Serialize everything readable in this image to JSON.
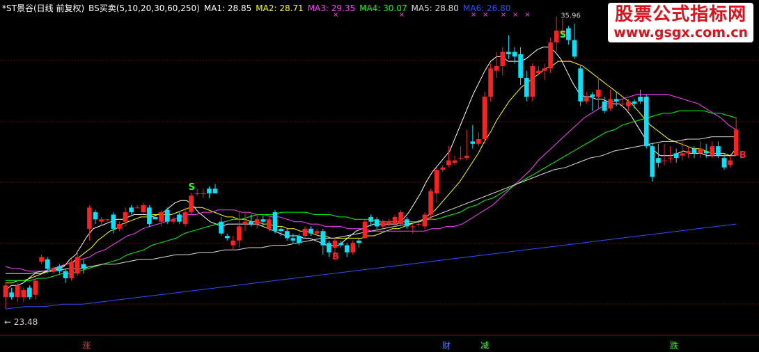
{
  "header": {
    "stock": "*ST景谷(日线 前复权)",
    "indicator": "BS买卖(5,10,20,30,60,250)",
    "ma": [
      {
        "label": "MA1: 28.85",
        "color": "#ffffff"
      },
      {
        "label": "MA2: 28.71",
        "color": "#ffff00"
      },
      {
        "label": "MA3: 29.35",
        "color": "#ff40ff"
      },
      {
        "label": "MA4: 30.07",
        "color": "#00ff00"
      },
      {
        "label": "MA5: 28.80",
        "color": "#dddddd"
      },
      {
        "label": "MA6: 26.80",
        "color": "#3050ff"
      }
    ]
  },
  "watermark": {
    "title": "股票公式指标网",
    "url": "www.gsgx.com.cn"
  },
  "low_label": "← 23.48",
  "bottom_flags": [
    {
      "text": "涨",
      "color": "#ff3030"
    },
    {
      "text": "财",
      "color": "#4080ff"
    },
    {
      "text": "减",
      "color": "#30ff30"
    },
    {
      "text": "跌",
      "color": "#30ff30"
    }
  ],
  "chart_data": {
    "type": "candlestick",
    "ylim": [
      22.5,
      36.6
    ],
    "candles": [
      [
        24.0,
        24.5,
        23.5,
        24.6
      ],
      [
        24.2,
        24.0,
        23.9,
        24.4
      ],
      [
        24.0,
        24.5,
        23.8,
        24.6
      ],
      [
        24.0,
        24.3,
        23.8,
        24.4
      ],
      [
        24.4,
        24.0,
        23.9,
        24.5
      ],
      [
        24.1,
        24.7,
        23.9,
        24.8
      ],
      [
        25.5,
        25.7,
        25.4,
        25.8
      ],
      [
        25.6,
        25.2,
        25.0,
        25.7
      ],
      [
        25.1,
        25.2,
        25.0,
        25.3
      ],
      [
        25.3,
        25.1,
        25.0,
        25.4
      ],
      [
        25.1,
        24.8,
        24.6,
        25.2
      ],
      [
        24.8,
        25.5,
        24.7,
        25.6
      ],
      [
        25.0,
        25.7,
        24.9,
        26.0
      ],
      [
        25.4,
        25.2,
        25.0,
        25.6
      ],
      [
        26.9,
        27.8,
        26.4,
        27.9
      ],
      [
        27.6,
        27.3,
        27.1,
        27.7
      ],
      [
        27.2,
        27.3,
        27.0,
        27.4
      ],
      [
        27.3,
        27.3,
        27.2,
        27.3
      ],
      [
        27.5,
        26.9,
        26.7,
        27.6
      ],
      [
        26.9,
        27.1,
        26.8,
        27.2
      ],
      [
        27.2,
        27.6,
        27.0,
        27.8
      ],
      [
        27.8,
        27.6,
        27.5,
        27.9
      ],
      [
        27.8,
        27.8,
        27.8,
        27.9
      ],
      [
        27.6,
        27.9,
        27.5,
        28.0
      ],
      [
        27.8,
        27.1,
        27.0,
        27.9
      ],
      [
        27.4,
        27.3,
        27.3,
        27.4
      ],
      [
        27.2,
        27.6,
        27.0,
        27.7
      ],
      [
        27.7,
        27.2,
        27.1,
        27.8
      ],
      [
        27.2,
        27.3,
        27.1,
        27.4
      ],
      [
        27.5,
        27.2,
        27.1,
        27.6
      ],
      [
        27.1,
        27.6,
        27.0,
        27.8
      ],
      [
        27.6,
        28.3,
        27.5,
        28.4
      ],
      [
        28.4,
        28.4,
        28.3,
        28.6
      ],
      [
        28.4,
        28.4,
        28.2,
        28.6
      ],
      [
        28.6,
        28.4,
        28.2,
        28.7
      ],
      [
        28.6,
        28.4,
        28.4,
        28.8
      ],
      [
        27.2,
        26.7,
        26.6,
        27.4
      ],
      [
        26.6,
        26.5,
        26.4,
        26.7
      ],
      [
        26.2,
        26.4,
        26.0,
        26.6
      ],
      [
        26.4,
        27.0,
        26.1,
        27.6
      ],
      [
        27.1,
        27.2,
        26.8,
        27.6
      ],
      [
        27.2,
        27.1,
        27.0,
        27.5
      ],
      [
        27.1,
        27.3,
        26.9,
        27.5
      ],
      [
        27.3,
        27.2,
        27.0,
        27.5
      ],
      [
        26.9,
        27.3,
        26.8,
        27.4
      ],
      [
        27.6,
        26.8,
        26.7,
        27.7
      ],
      [
        26.9,
        26.8,
        26.6,
        27.0
      ],
      [
        26.8,
        26.5,
        26.4,
        26.9
      ],
      [
        26.5,
        26.4,
        26.3,
        26.7
      ],
      [
        26.6,
        26.3,
        26.2,
        26.7
      ],
      [
        26.6,
        26.9,
        26.5,
        27.0
      ],
      [
        26.9,
        26.7,
        26.6,
        27.0
      ],
      [
        26.7,
        26.8,
        26.6,
        26.9
      ],
      [
        26.8,
        26.2,
        25.8,
        26.9
      ],
      [
        26.3,
        25.9,
        25.7,
        26.4
      ],
      [
        26.1,
        26.4,
        25.8,
        26.5
      ],
      [
        26.3,
        26.2,
        26.1,
        26.4
      ],
      [
        26.2,
        25.9,
        25.7,
        26.3
      ],
      [
        25.9,
        26.3,
        25.8,
        26.4
      ],
      [
        26.4,
        26.3,
        26.1,
        26.5
      ],
      [
        26.5,
        27.2,
        26.5,
        27.3
      ],
      [
        27.4,
        27.2,
        27.0,
        27.5
      ],
      [
        27.3,
        27.0,
        26.9,
        27.4
      ],
      [
        27.0,
        27.2,
        26.9,
        27.3
      ],
      [
        27.1,
        27.2,
        27.0,
        27.3
      ],
      [
        27.1,
        27.4,
        27.0,
        27.5
      ],
      [
        27.1,
        27.6,
        27.0,
        27.7
      ],
      [
        27.3,
        27.0,
        26.9,
        27.4
      ],
      [
        27.0,
        27.0,
        26.7,
        27.1
      ],
      [
        27.1,
        27.1,
        27.0,
        27.2
      ],
      [
        27.0,
        27.5,
        26.9,
        27.6
      ],
      [
        27.5,
        28.5,
        27.3,
        28.6
      ],
      [
        28.4,
        29.4,
        28.0,
        29.5
      ],
      [
        29.4,
        29.5,
        29.3,
        29.6
      ],
      [
        29.6,
        29.8,
        29.5,
        30.4
      ],
      [
        29.7,
        29.8,
        29.6,
        30.0
      ],
      [
        29.9,
        29.9,
        29.8,
        30.4
      ],
      [
        29.9,
        30.0,
        29.8,
        31.1
      ],
      [
        30.6,
        30.5,
        30.3,
        31.3
      ],
      [
        30.5,
        30.7,
        30.4,
        31.0
      ],
      [
        30.7,
        32.5,
        30.5,
        32.7
      ],
      [
        32.5,
        33.7,
        32.3,
        33.9
      ],
      [
        33.6,
        33.8,
        33.3,
        34.4
      ],
      [
        33.8,
        34.4,
        33.4,
        34.6
      ],
      [
        34.4,
        34.3,
        34.1,
        35.1
      ],
      [
        34.4,
        34.2,
        33.9,
        34.6
      ],
      [
        34.3,
        33.3,
        33.0,
        34.6
      ],
      [
        33.3,
        32.5,
        32.3,
        33.6
      ],
      [
        32.5,
        33.8,
        32.3,
        33.9
      ],
      [
        33.5,
        33.6,
        33.4,
        33.8
      ],
      [
        33.6,
        33.7,
        33.2,
        33.9
      ],
      [
        33.7,
        34.8,
        33.5,
        35.0
      ],
      [
        34.8,
        35.3,
        34.4,
        35.9
      ],
      [
        35.2,
        35.3,
        35.0,
        35.8
      ],
      [
        35.4,
        34.9,
        34.7,
        35.5
      ],
      [
        34.9,
        34.2,
        34.1,
        35.6
      ],
      [
        33.7,
        32.3,
        32.1,
        33.8
      ],
      [
        32.3,
        32.5,
        32.2,
        32.7
      ],
      [
        32.6,
        32.5,
        31.9,
        32.7
      ],
      [
        32.5,
        32.8,
        32.0,
        33.3
      ],
      [
        32.3,
        31.9,
        31.8,
        32.5
      ],
      [
        32.0,
        32.4,
        31.9,
        32.8
      ],
      [
        32.4,
        32.3,
        32.1,
        32.7
      ],
      [
        32.2,
        32.2,
        32.1,
        32.4
      ],
      [
        32.1,
        32.3,
        31.9,
        32.4
      ],
      [
        32.3,
        32.2,
        32.0,
        32.4
      ],
      [
        32.5,
        32.3,
        32.2,
        32.8
      ],
      [
        32.5,
        30.4,
        30.3,
        32.6
      ],
      [
        30.4,
        29.1,
        28.9,
        30.5
      ],
      [
        29.9,
        29.7,
        29.5,
        30.5
      ],
      [
        29.8,
        29.8,
        29.6,
        30.5
      ],
      [
        29.9,
        29.9,
        29.7,
        30.4
      ],
      [
        30.1,
        29.9,
        29.7,
        30.3
      ],
      [
        30.0,
        30.1,
        29.8,
        30.7
      ],
      [
        30.1,
        30.2,
        29.9,
        30.4
      ],
      [
        30.3,
        30.1,
        29.9,
        30.4
      ],
      [
        30.1,
        30.3,
        29.9,
        30.6
      ],
      [
        30.2,
        30.1,
        29.9,
        30.5
      ],
      [
        30.0,
        30.4,
        29.9,
        30.6
      ],
      [
        30.4,
        30.0,
        29.9,
        30.6
      ],
      [
        29.9,
        29.5,
        29.4,
        30.1
      ],
      [
        29.6,
        29.8,
        29.5,
        30.0
      ],
      [
        30.0,
        31.1,
        30.0,
        31.6
      ]
    ],
    "ma_lines": [
      {
        "name": "MA1",
        "color": "#ffffff",
        "values": [
          24.3,
          24.5,
          24.5,
          24.6,
          24.8,
          25.0,
          25.0,
          25.1,
          25.1,
          25.2,
          25.3,
          25.6,
          25.8,
          26.2,
          26.6,
          26.9,
          27.0,
          27.1,
          27.2,
          27.3,
          27.3,
          27.4,
          27.5,
          27.5,
          27.5,
          27.4,
          27.5,
          27.6,
          27.8,
          28.0,
          28.1,
          28.1,
          27.9,
          27.6,
          27.4,
          27.2,
          27.1,
          27.0,
          27.1,
          27.1,
          27.1,
          27.1,
          27.1,
          27.1,
          27.0,
          26.9,
          26.8,
          26.7,
          26.6,
          26.6,
          26.6,
          26.5,
          26.5,
          26.4,
          26.3,
          26.2,
          26.2,
          26.2,
          26.4,
          26.6,
          26.8,
          26.9,
          27.0,
          27.1,
          27.1,
          27.1,
          27.1,
          27.1,
          27.3,
          27.6,
          28.0,
          28.4,
          28.9,
          29.3,
          29.6,
          29.9,
          30.2,
          30.8,
          31.4,
          32.0,
          32.6,
          33.1,
          33.6,
          34.0,
          34.2,
          34.2,
          34.0,
          34.0,
          34.0,
          34.1,
          34.3,
          34.5,
          34.6,
          34.6,
          34.4,
          34.1,
          33.6,
          33.1,
          32.7,
          32.5,
          32.5,
          32.4,
          32.4,
          32.3,
          32.2,
          32.2,
          32.0,
          31.7,
          31.3,
          30.9,
          30.5,
          30.2,
          30.0,
          30.0,
          30.0,
          30.1,
          30.2,
          30.1,
          30.1,
          30.1,
          30.0,
          30.0,
          30.0,
          30.0,
          30.0,
          30.3
        ]
      },
      {
        "name": "MA2",
        "color": "#ffff00",
        "values": [
          24.6,
          24.6,
          24.7,
          24.7,
          24.8,
          24.9,
          25.0,
          25.1,
          25.2,
          25.3,
          25.4,
          25.5,
          25.7,
          25.9,
          26.1,
          26.4,
          26.6,
          26.8,
          26.9,
          27.1,
          27.2,
          27.3,
          27.4,
          27.4,
          27.5,
          27.5,
          27.5,
          27.5,
          27.6,
          27.7,
          27.8,
          27.8,
          27.8,
          27.7,
          27.6,
          27.5,
          27.4,
          27.4,
          27.3,
          27.3,
          27.2,
          27.2,
          27.1,
          27.1,
          27.0,
          27.0,
          26.9,
          26.9,
          26.8,
          26.8,
          26.7,
          26.6,
          26.6,
          26.5,
          26.5,
          26.5,
          26.5,
          26.5,
          26.5,
          26.6,
          26.6,
          26.7,
          26.8,
          26.9,
          26.9,
          27.0,
          27.1,
          27.2,
          27.3,
          27.5,
          27.7,
          28.0,
          28.3,
          28.6,
          28.9,
          29.3,
          29.7,
          30.1,
          30.6,
          31.0,
          31.5,
          31.9,
          32.3,
          32.6,
          32.9,
          33.1,
          33.3,
          33.5,
          33.7,
          33.8,
          34.0,
          34.0,
          34.0,
          33.9,
          33.8,
          33.6,
          33.4,
          33.2,
          33.0,
          32.8,
          32.6,
          32.4,
          32.2,
          31.9,
          31.6,
          31.3,
          31.1,
          30.9,
          30.7,
          30.6,
          30.5,
          30.4,
          30.3,
          30.3,
          30.2,
          30.1,
          30.1,
          30.1,
          30.0,
          30.0
        ]
      },
      {
        "name": "MA3",
        "color": "#ff40ff",
        "values": [
          25.3,
          25.2,
          25.2,
          25.1,
          25.1,
          25.1,
          25.2,
          25.3,
          25.4,
          25.5,
          25.6,
          25.7,
          25.9,
          26.0,
          26.2,
          26.4,
          26.6,
          26.7,
          26.9,
          27.0,
          27.1,
          27.2,
          27.3,
          27.4,
          27.5,
          27.5,
          27.6,
          27.6,
          27.7,
          27.7,
          27.7,
          27.6,
          27.6,
          27.5,
          27.5,
          27.4,
          27.4,
          27.3,
          27.2,
          27.2,
          27.1,
          27.1,
          27.0,
          27.0,
          27.0,
          26.9,
          26.9,
          26.9,
          26.8,
          26.8,
          26.8,
          26.8,
          26.8,
          26.8,
          26.8,
          26.8,
          26.9,
          26.9,
          27.0,
          27.0,
          27.1,
          27.3,
          27.5,
          27.7,
          27.9,
          28.2,
          28.5,
          28.8,
          29.1,
          29.4,
          29.8,
          30.1,
          30.4,
          30.7,
          31.0,
          31.3,
          31.6,
          31.8,
          32.0,
          32.2,
          32.3,
          32.4,
          32.5,
          32.6,
          32.6,
          32.6,
          32.6,
          32.6,
          32.5,
          32.4,
          32.3,
          32.2,
          32.0,
          31.8,
          31.6,
          31.3,
          31.1
        ]
      },
      {
        "name": "MA4",
        "color": "#00ff00",
        "values": [
          24.7,
          24.7,
          24.7,
          24.7,
          24.8,
          24.8,
          24.9,
          25.0,
          25.0,
          25.1,
          25.2,
          25.3,
          25.4,
          25.5,
          25.6,
          25.8,
          25.9,
          26.0,
          26.2,
          26.3,
          26.4,
          26.5,
          26.7,
          26.8,
          26.9,
          27.0,
          27.1,
          27.2,
          27.3,
          27.3,
          27.4,
          27.5,
          27.5,
          27.5,
          27.6,
          27.6,
          27.6,
          27.6,
          27.5,
          27.5,
          27.5,
          27.4,
          27.4,
          27.3,
          27.3,
          27.3,
          27.2,
          27.2,
          27.2,
          27.2,
          27.2,
          27.2,
          27.3,
          27.3,
          27.4,
          27.5,
          27.6,
          27.8,
          27.9,
          28.1,
          28.2,
          28.4,
          28.6,
          28.8,
          29.0,
          29.2,
          29.4,
          29.6,
          29.8,
          30.0,
          30.2,
          30.4,
          30.6,
          30.8,
          31.0,
          31.1,
          31.3,
          31.4,
          31.5,
          31.6,
          31.7,
          31.8,
          31.8,
          31.9,
          31.9,
          31.9,
          31.9,
          31.8,
          31.8,
          31.7,
          31.6
        ]
      },
      {
        "name": "MA5",
        "color": "#dddddd",
        "values": [
          25.0,
          25.0,
          25.0,
          25.1,
          25.1,
          25.2,
          25.2,
          25.3,
          25.4,
          25.4,
          25.5,
          25.6,
          25.6,
          25.7,
          25.8,
          25.8,
          25.9,
          25.9,
          26.0,
          26.0,
          26.1,
          26.1,
          26.2,
          26.2,
          26.3,
          26.4,
          26.5,
          26.5,
          26.6,
          26.7,
          26.8,
          26.9,
          27.0,
          27.1,
          27.2,
          27.4,
          27.6,
          27.8,
          28.0,
          28.2,
          28.4,
          28.6,
          28.8,
          29.0,
          29.2,
          29.4,
          29.5,
          29.7,
          29.9,
          30.0,
          30.2,
          30.3,
          30.4,
          30.5,
          30.6,
          30.6,
          30.7,
          30.7,
          30.8,
          30.8,
          30.8
        ]
      },
      {
        "name": "MA6",
        "color": "#3050ff",
        "values": [
          23.5,
          23.6,
          23.6,
          23.7,
          23.7,
          23.8,
          23.9,
          24.0,
          24.1,
          24.2,
          24.3,
          24.4,
          24.5,
          24.6,
          24.7,
          24.8,
          24.9,
          25.0,
          25.1,
          25.2,
          25.3,
          25.4,
          25.5,
          25.6,
          25.7,
          25.8,
          25.9,
          26.0,
          26.1,
          26.2,
          26.3,
          26.4,
          26.5,
          26.6,
          26.7,
          26.8,
          26.9,
          27.0,
          27.1
        ]
      }
    ],
    "signals": [
      {
        "text": "S",
        "index": 31,
        "color": "#30ff30",
        "value": 28.55
      },
      {
        "text": "B",
        "index": 55,
        "color": "#ff2020",
        "value": 25.6
      },
      {
        "text": "S",
        "index": 93,
        "color": "#30ff30",
        "value": 35.0
      },
      {
        "text": "B",
        "index": 123,
        "color": "#ff2020",
        "value": 29.9
      }
    ],
    "top_marks": [
      55,
      66,
      78,
      80,
      83,
      85,
      87
    ],
    "high_label": "35.96"
  }
}
